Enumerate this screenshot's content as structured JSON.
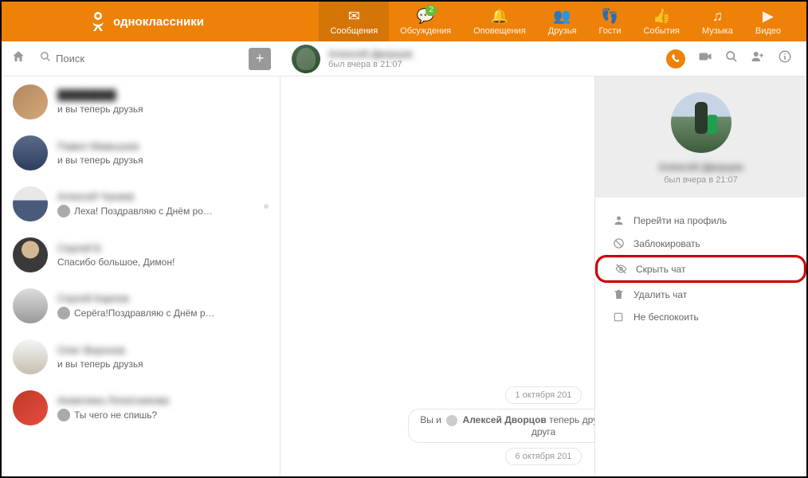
{
  "brand": {
    "name": "одноклассники"
  },
  "nav": [
    {
      "label": "Сообщения",
      "icon": "✉",
      "active": true
    },
    {
      "label": "Обсуждения",
      "icon": "💬",
      "badge": "2"
    },
    {
      "label": "Оповещения",
      "icon": "🔔"
    },
    {
      "label": "Друзья",
      "icon": "👥"
    },
    {
      "label": "Гости",
      "icon": "👣"
    },
    {
      "label": "События",
      "icon": "👍"
    },
    {
      "label": "Музыка",
      "icon": "♫"
    },
    {
      "label": "Видео",
      "icon": "▶"
    }
  ],
  "search": {
    "placeholder": "Поиск"
  },
  "chat_header": {
    "name": "Алексей Дворцов",
    "status": "был вчера в 21:07"
  },
  "conversations": [
    {
      "name": "████████",
      "msg": "и вы теперь друзья",
      "avatar": "av1"
    },
    {
      "name": "Павел Мамышев",
      "msg": "и вы теперь друзья",
      "avatar": "av2"
    },
    {
      "name": "Алексей Чукаев",
      "msg": "Леха! Поздравляю с Днём ро…",
      "avatar": "av3",
      "hasMiniAvatar": true,
      "dot": true
    },
    {
      "name": "Сергей Б",
      "msg": "Спасибо большое, Димон!",
      "avatar": "av4"
    },
    {
      "name": "Сергей Карпов",
      "msg": "Серёга!Поздравляю с Днём р…",
      "avatar": "av5",
      "hasMiniAvatar": true
    },
    {
      "name": "Олег Воронов",
      "msg": "и вы теперь друзья",
      "avatar": "av6"
    },
    {
      "name": "Анжелика Лопатникова",
      "msg": "Ты чего не спишь?",
      "avatar": "av7",
      "hasMiniAvatar": true
    }
  ],
  "messages": {
    "date1": "1 октября 201",
    "friends_text_a": "Вы и",
    "friends_name": "Алексей Дворцов",
    "friends_text_b": "теперь друзья на Однокла",
    "friends_text_c": "друга",
    "date2": "6 октября 201"
  },
  "panel": {
    "name": "Алексей Дворцов",
    "status": "был вчера в 21:07",
    "menu": [
      {
        "label": "Перейти на профиль",
        "icon": "profile"
      },
      {
        "label": "Заблокировать",
        "icon": "block"
      },
      {
        "label": "Скрыть чат",
        "icon": "hide",
        "highlight": true
      },
      {
        "label": "Удалить чат",
        "icon": "delete"
      },
      {
        "label": "Не беспокоить",
        "icon": "dnd"
      }
    ]
  }
}
